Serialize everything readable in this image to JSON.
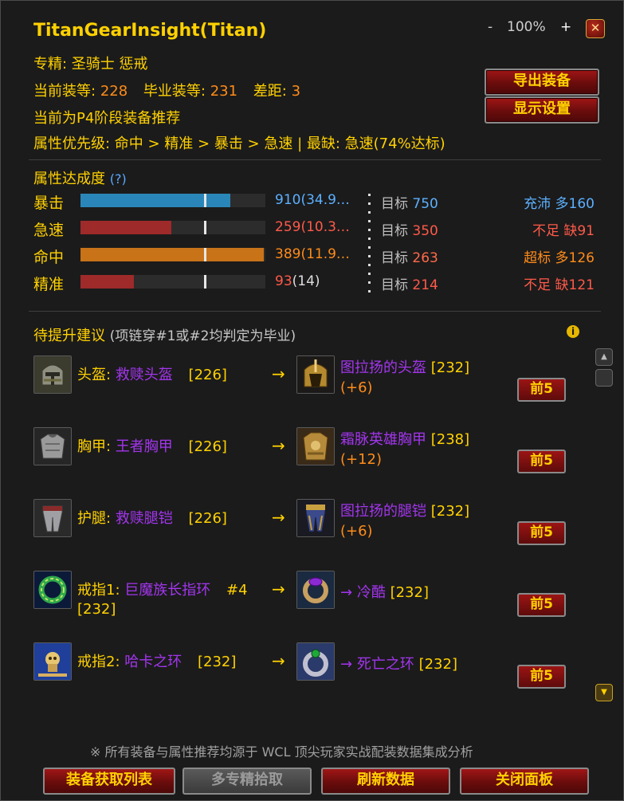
{
  "window": {
    "title": "TitanGearInsight(Titan)",
    "zoom_minus": "-",
    "zoom_level": "100%",
    "zoom_plus": "+",
    "close": "✕"
  },
  "info": {
    "spec": "专精: 圣骑士 惩戒",
    "current_label": "当前装等:",
    "current_value": "228",
    "bis_label": "毕业装等:",
    "bis_value": "231",
    "gap_label": "差距:",
    "gap_value": "3",
    "phase": "当前为P4阶段装备推荐",
    "priority": "属性优先级: 命中 > 精准 > 暴击 > 急速  |  最缺: 急速(74%达标)"
  },
  "buttons": {
    "export": "导出装备",
    "display_settings": "显示设置"
  },
  "stats_section": {
    "title": "属性达成度",
    "help": "(?)",
    "target_label": "目标",
    "rows": [
      {
        "name": "暴击",
        "value": "910",
        "paren": "(34.9…",
        "target": "750",
        "note": "充沛 多160",
        "fill": 0.81,
        "marker": 0.67,
        "bar_color": "#2a86b8",
        "value_color": "#5cb0ff",
        "paren_color": "#5cb0ff",
        "target_color": "#5cb0ff",
        "note_color": "#5cb0ff"
      },
      {
        "name": "急速",
        "value": "259",
        "paren": "(10.3…",
        "target": "350",
        "note": "不足 缺91",
        "fill": 0.49,
        "marker": 0.67,
        "bar_color": "#9e2a2a",
        "value_color": "#ff5a4a",
        "paren_color": "#ff5a4a",
        "target_color": "#ff5a4a",
        "note_color": "#ff5a4a"
      },
      {
        "name": "命中",
        "value": "389",
        "paren": "(11.9…",
        "target": "263",
        "note": "超标 多126",
        "fill": 0.99,
        "marker": 0.67,
        "bar_color": "#c87318",
        "value_color": "#ff8c1a",
        "paren_color": "#ff8c1a",
        "target_color": "#ff6a4a",
        "note_color": "#ff8c1a"
      },
      {
        "name": "精准",
        "value": "93",
        "paren": "(14)",
        "target": "214",
        "note": "不足 缺121",
        "fill": 0.29,
        "marker": 0.67,
        "bar_color": "#9e2a2a",
        "value_color": "#ff5a4a",
        "paren_color": "#dddddd",
        "target_color": "#ff5a4a",
        "note_color": "#ff5a4a"
      }
    ]
  },
  "suggestions": {
    "title": "待提升建议",
    "subtitle": "(项链穿#1或#2均判定为毕业)",
    "info_icon": "i",
    "top_label": "前5",
    "arrow": "→",
    "items": [
      {
        "slot": "头盔:",
        "current": "救赎头盔",
        "current_ilvl": "[226]",
        "rec": "图拉扬的头盔",
        "rec_ilvl": "[232]",
        "gain": "(+6)",
        "cur_icon": "helmet-icon",
        "rec_icon": "helmet-gold-icon"
      },
      {
        "slot": "胸甲:",
        "current": "王者胸甲",
        "current_ilvl": "[226]",
        "rec": "霜脉英雄胸甲",
        "rec_ilvl": "[238]",
        "gain": "(+12)",
        "cur_icon": "chest-armor-icon",
        "rec_icon": "chest-gold-icon"
      },
      {
        "slot": "护腿:",
        "current": "救赎腿铠",
        "current_ilvl": "[226]",
        "rec": "图拉扬的腿铠",
        "rec_ilvl": "[232]",
        "gain": "(+6)",
        "cur_icon": "legs-armor-icon",
        "rec_icon": "legs-blue-icon"
      },
      {
        "slot": "戒指1:",
        "current": "巨魔族长指环",
        "rank": "#4",
        "current_ilvl": "[232]",
        "rec_prefix": "→",
        "rec": "冷酷",
        "rec_ilvl": "[232]",
        "cur_icon": "ring-green-icon",
        "rec_icon": "ring-purple-icon"
      },
      {
        "slot": "戒指2:",
        "current": "哈卡之环",
        "current_ilvl": "[232]",
        "rec_prefix": "→",
        "rec": "死亡之环",
        "rec_ilvl": "[232]",
        "cur_icon": "ring-skull-icon",
        "rec_icon": "ring-green-gem-icon"
      }
    ]
  },
  "footer": {
    "note": "※ 所有装备与属性推荐均源于 WCL 顶尖玩家实战配装数据集成分析",
    "btn_gear_list": "装备获取列表",
    "btn_multi_spec": "多专精拾取",
    "btn_refresh": "刷新数据",
    "btn_close": "关闭面板"
  }
}
